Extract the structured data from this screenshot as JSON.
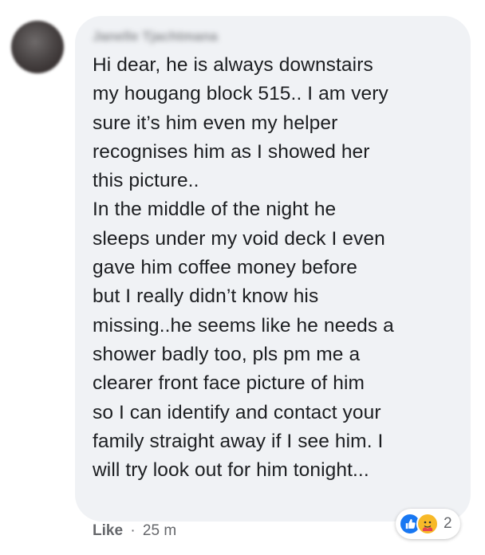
{
  "comment": {
    "author": "Janelle Tjachtmana",
    "lines": [
      "Hi dear, he is always downstairs",
      "my hougang block 515.. I am very",
      "sure it’s him even my helper",
      "recognises him as I showed her",
      "this picture..",
      "In the middle of the night he",
      "sleeps under my void deck I even",
      "gave him coffee money before",
      "but I really didn’t know his",
      "missing..he seems like he needs a",
      "shower badly too, pls pm me a",
      "clearer front face picture of him",
      "so I can identify and contact your",
      "family straight away if I see him. I",
      "will try look out for him tonight..."
    ]
  },
  "reactions": {
    "icons": [
      "like-icon",
      "care-icon"
    ],
    "count": "2",
    "colors": {
      "like": "#1877f2",
      "care": "#f7b928"
    }
  },
  "actions": {
    "like_label": "Like",
    "separator": "·",
    "timestamp": "25 m"
  }
}
